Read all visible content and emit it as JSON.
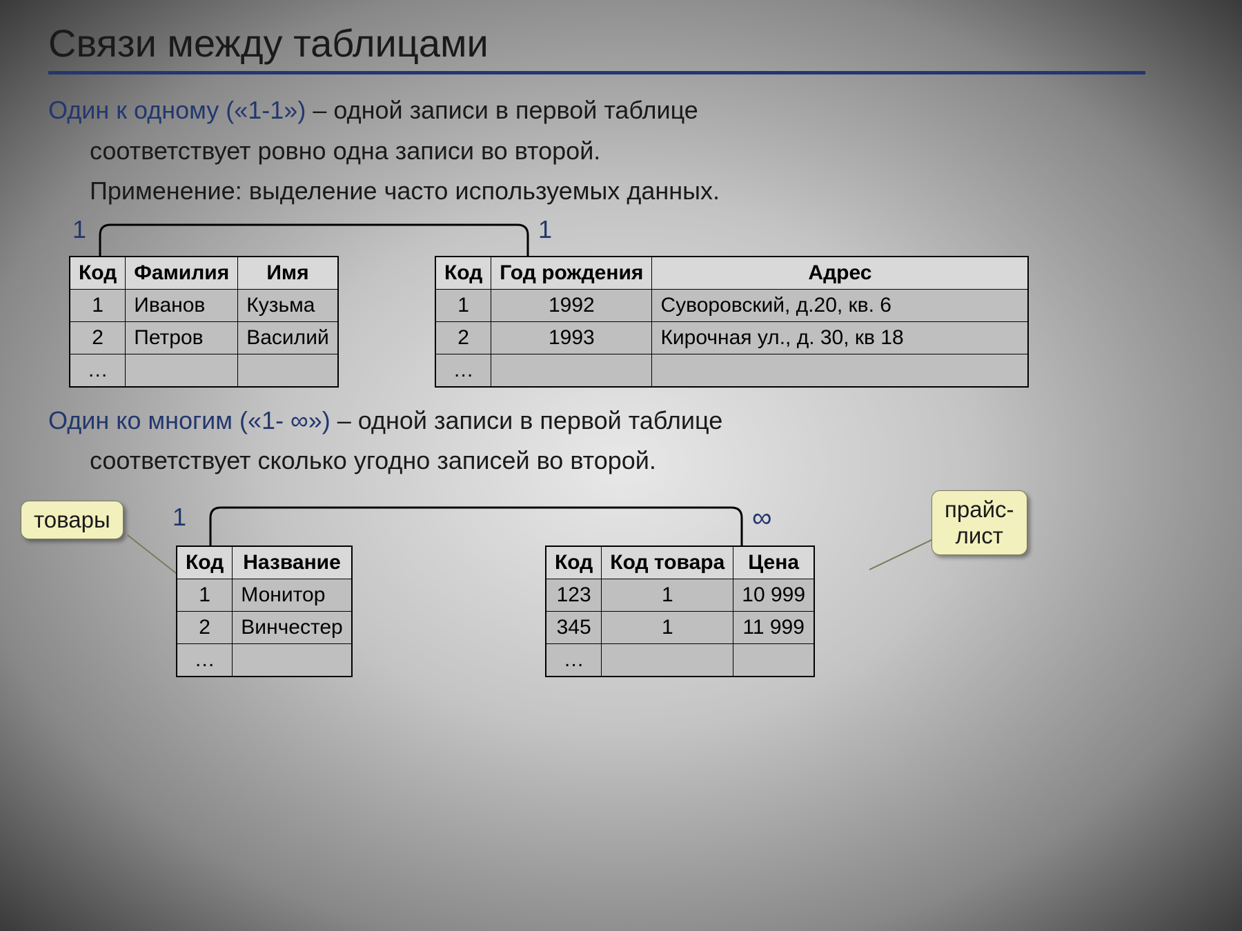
{
  "title": "Связи между таблицами",
  "section1": {
    "lead": "Один к одному («1-1»)",
    "rest": " – одной записи в первой таблице",
    "line2": "соответствует ровно одна записи во второй.",
    "line3": "Применение: выделение часто используемых данных.",
    "left_card": "1",
    "right_card": "1",
    "tableA": {
      "headers": [
        "Код",
        "Фамилия",
        "Имя"
      ],
      "rows": [
        [
          "1",
          "Иванов",
          "Кузьма"
        ],
        [
          "2",
          "Петров",
          "Василий"
        ],
        [
          "…",
          "",
          ""
        ]
      ]
    },
    "tableB": {
      "headers": [
        "Код",
        "Год рождения",
        "Адрес"
      ],
      "rows": [
        [
          "1",
          "1992",
          "Суворовский, д.20, кв. 6"
        ],
        [
          "2",
          "1993",
          "Кирочная ул., д. 30, кв 18"
        ],
        [
          "…",
          "",
          ""
        ]
      ]
    }
  },
  "section2": {
    "lead": "Один ко многим («1- ∞»)",
    "rest": " – одной записи в первой таблице",
    "line2": "соответствует сколько угодно записей во второй.",
    "left_card": "1",
    "right_card": "∞",
    "callout_left": "товары",
    "callout_right": "прайс-\nлист",
    "tableA": {
      "headers": [
        "Код",
        "Название"
      ],
      "rows": [
        [
          "1",
          "Монитор"
        ],
        [
          "2",
          "Винчестер"
        ],
        [
          "…",
          ""
        ]
      ]
    },
    "tableB": {
      "headers": [
        "Код",
        "Код товара",
        "Цена"
      ],
      "rows": [
        [
          "123",
          "1",
          "10 999"
        ],
        [
          "345",
          "1",
          "11 999"
        ],
        [
          "…",
          "",
          ""
        ]
      ]
    }
  }
}
